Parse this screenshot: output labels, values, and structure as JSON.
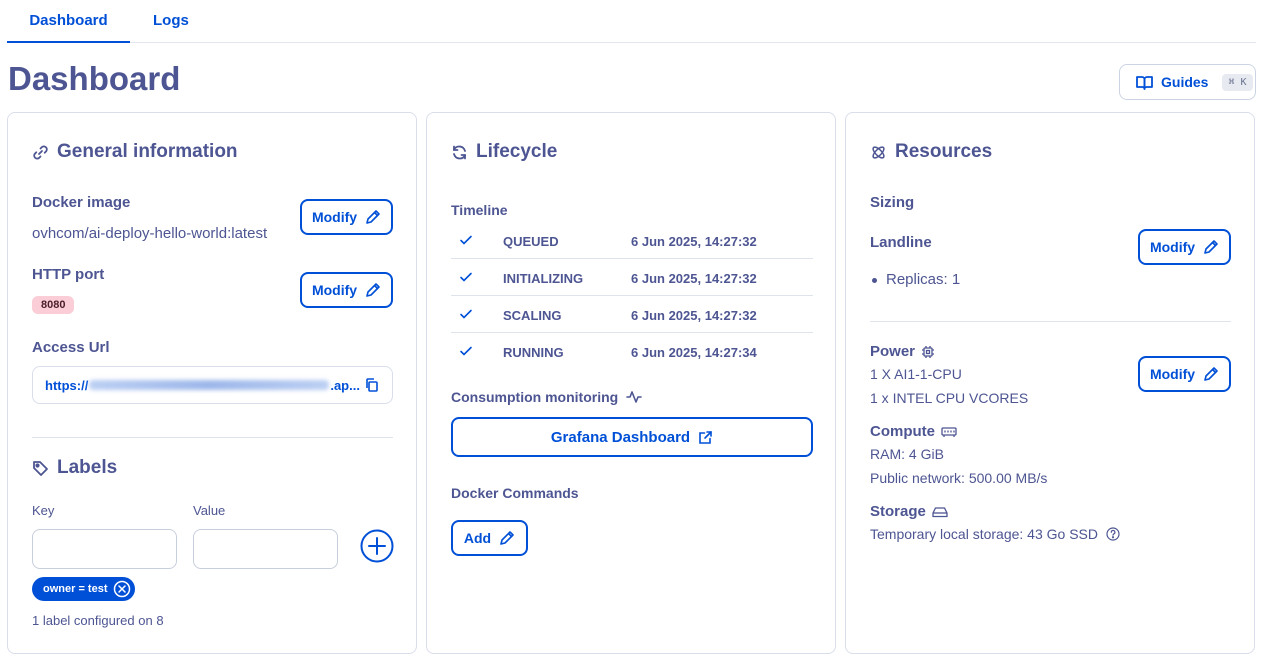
{
  "tabs": [
    {
      "label": "Dashboard",
      "active": true
    },
    {
      "label": "Logs",
      "active": false
    }
  ],
  "page_title": "Dashboard",
  "guides": {
    "label": "Guides",
    "shortcut": "⌘ K"
  },
  "general": {
    "title": "General information",
    "docker_image_label": "Docker image",
    "docker_image_value": "ovhcom/ai-deploy-hello-world:latest",
    "http_port_label": "HTTP port",
    "http_port_value": "8080",
    "access_url_label": "Access Url",
    "access_url_prefix": "https://",
    "access_url_suffix": ".ap...",
    "modify_label": "Modify"
  },
  "labels": {
    "title": "Labels",
    "key_label": "Key",
    "value_label": "Value",
    "key_placeholder": "",
    "value_placeholder": "",
    "chip": "owner = test",
    "count_text": "1 label configured on 8"
  },
  "lifecycle": {
    "title": "Lifecycle",
    "timeline_label": "Timeline",
    "timeline": [
      {
        "status": "QUEUED",
        "date": "6 Jun 2025, 14:27:32"
      },
      {
        "status": "INITIALIZING",
        "date": "6 Jun 2025, 14:27:32"
      },
      {
        "status": "SCALING",
        "date": "6 Jun 2025, 14:27:32"
      },
      {
        "status": "RUNNING",
        "date": "6 Jun 2025, 14:27:34"
      }
    ],
    "consumption_label": "Consumption monitoring",
    "grafana_label": "Grafana Dashboard",
    "docker_commands_label": "Docker Commands",
    "add_label": "Add"
  },
  "resources": {
    "title": "Resources",
    "sizing_label": "Sizing",
    "landline_label": "Landline",
    "replicas": "Replicas: 1",
    "power_label": "Power",
    "power_line1": "1 X AI1-1-CPU",
    "power_line2": "1 x INTEL CPU VCORES",
    "compute_label": "Compute",
    "ram": "RAM: 4 GiB",
    "network": "Public network: 500.00 MB/s",
    "storage_label": "Storage",
    "storage_value": "Temporary local storage: 43 Go SSD",
    "modify_label": "Modify"
  },
  "colors": {
    "primary": "#0050d7",
    "text": "#4d5592",
    "port_badge": "#fbcdd7"
  }
}
